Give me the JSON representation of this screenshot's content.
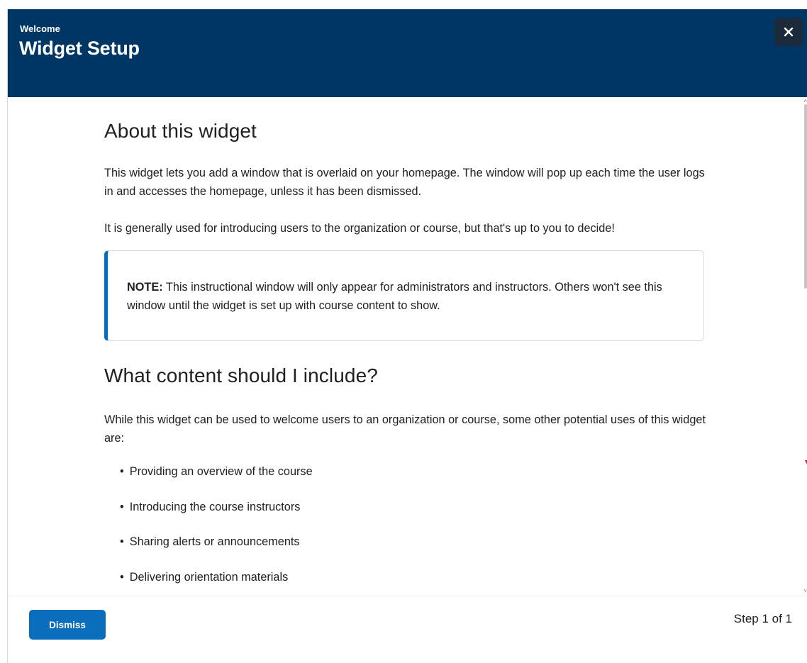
{
  "header": {
    "kicker": "Welcome",
    "title": "Widget Setup",
    "close_icon": "close-icon"
  },
  "content": {
    "about": {
      "heading": "About this widget",
      "para1": "This widget lets you add a window that is overlaid on your homepage. The window will pop up each time the user logs in and accesses the homepage, unless it has been dismissed.",
      "para2": "It is generally used for introducing users to the organization or course, but that's up to you to decide!"
    },
    "note": {
      "label": "NOTE:",
      "text": " This instructional window will only appear for administrators and instructors. Others won't see this window until the widget is set up with course content to show."
    },
    "include": {
      "heading": "What content should I include?",
      "intro": "While this widget can be used to welcome users to an organization or course, some other potential uses of this widget are:",
      "items": [
        "Providing an overview of the course",
        "Introducing the course instructors",
        "Sharing alerts or announcements",
        "Delivering orientation materials"
      ]
    }
  },
  "footer": {
    "dismiss_label": "Dismiss",
    "step_label": "Step 1 of 1"
  },
  "colors": {
    "header_bg": "#003663",
    "accent_blue": "#006fbf",
    "button_blue": "#0a6ebd"
  }
}
